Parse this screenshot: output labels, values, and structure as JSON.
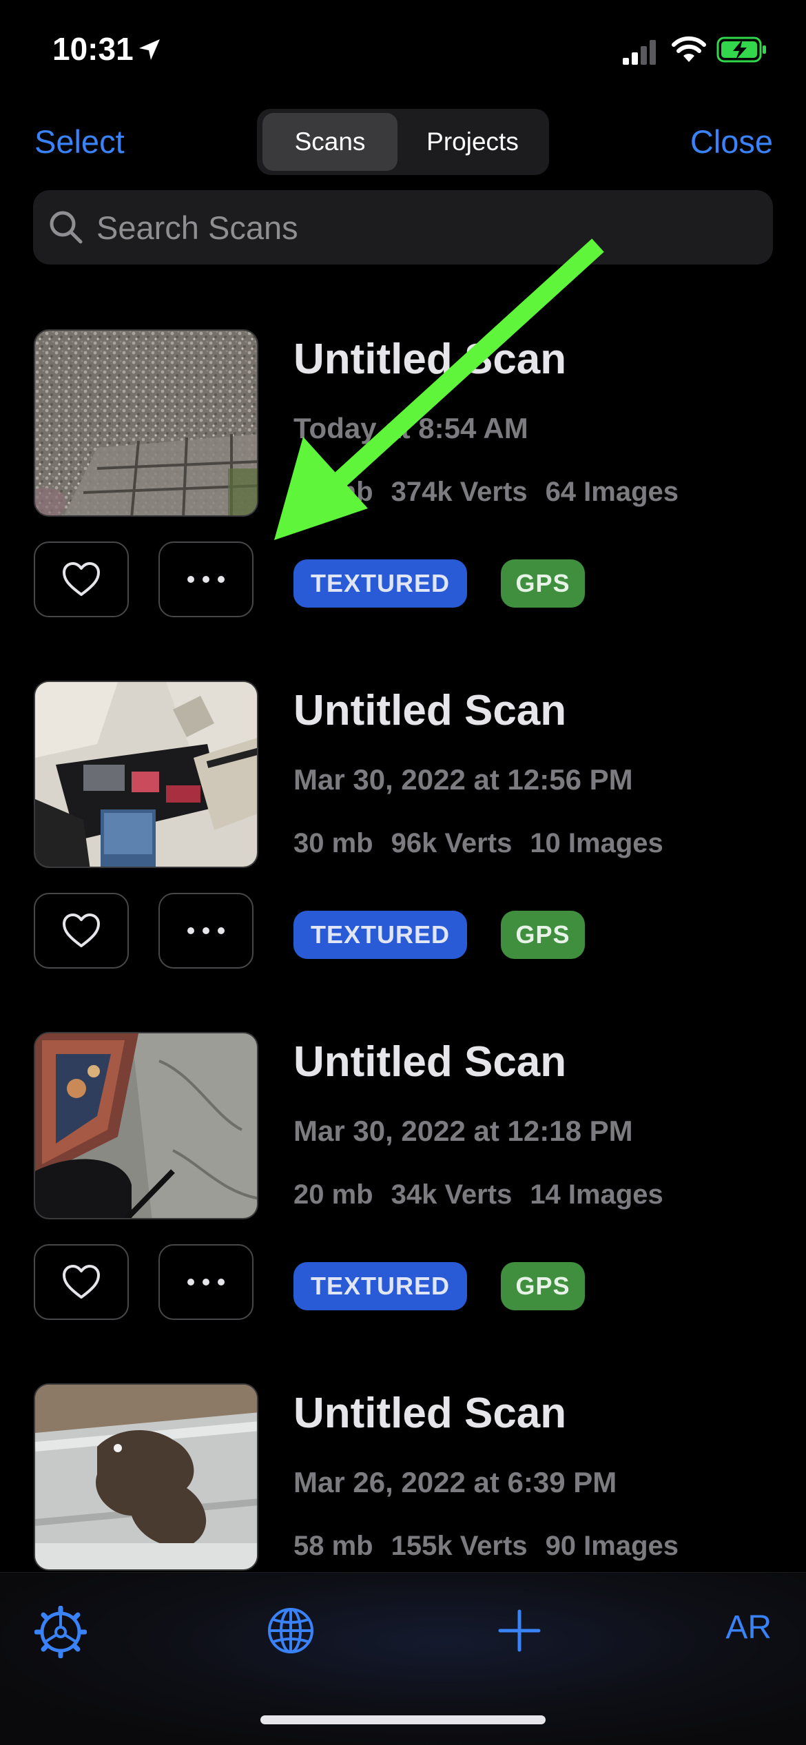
{
  "status_bar": {
    "time": "10:31"
  },
  "header": {
    "select_label": "Select",
    "close_label": "Close",
    "segments": [
      {
        "label": "Scans",
        "selected": true
      },
      {
        "label": "Projects",
        "selected": false
      }
    ]
  },
  "search": {
    "placeholder": "Search Scans",
    "value": ""
  },
  "scans": [
    {
      "title": "Untitled Scan",
      "date": "Today at 8:54 AM",
      "size": "76 mb",
      "verts": "374k Verts",
      "images": "64 Images",
      "badges": [
        "TEXTURED",
        "GPS"
      ]
    },
    {
      "title": "Untitled Scan",
      "date": "Mar 30, 2022 at 12:56 PM",
      "size": "30 mb",
      "verts": "96k Verts",
      "images": "10 Images",
      "badges": [
        "TEXTURED",
        "GPS"
      ]
    },
    {
      "title": "Untitled Scan",
      "date": "Mar 30, 2022 at 12:18 PM",
      "size": "20 mb",
      "verts": "34k Verts",
      "images": "14 Images",
      "badges": [
        "TEXTURED",
        "GPS"
      ]
    },
    {
      "title": "Untitled Scan",
      "date": "Mar 26, 2022 at 6:39 PM",
      "size": "58 mb",
      "verts": "155k Verts",
      "images": "90 Images"
    }
  ],
  "tab_bar": {
    "ar_label": "AR"
  },
  "colors": {
    "accent": "#3a82f7",
    "textured_badge": "#2a5bd7",
    "gps_badge": "#3f8f3f",
    "annotation_arrow": "#5ff53a",
    "battery_charging": "#32d74b"
  },
  "icons": [
    "location-arrow-icon",
    "cellular-signal-icon",
    "wifi-icon",
    "battery-charging-icon",
    "search-icon",
    "heart-icon",
    "ellipsis-icon",
    "settings-gear-icon",
    "globe-icon",
    "plus-icon"
  ]
}
